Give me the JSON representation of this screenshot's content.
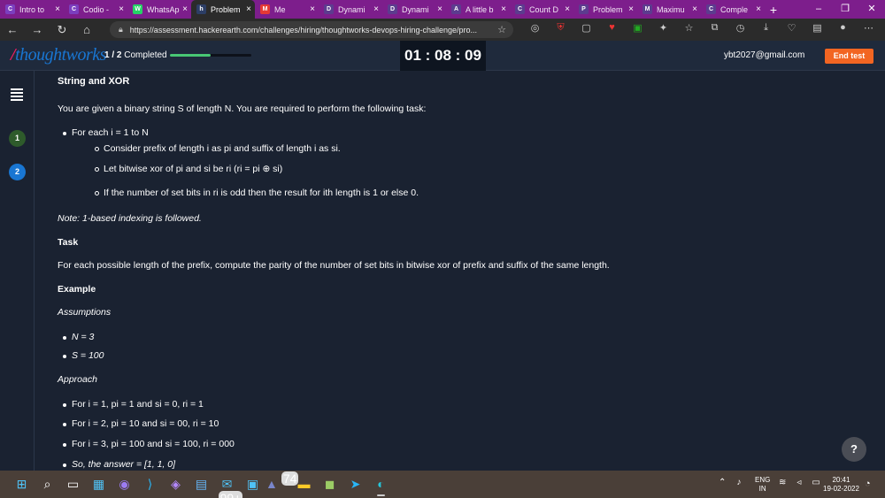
{
  "browser": {
    "tabs": [
      {
        "label": "Intro to",
        "icon": "C",
        "color": "#7b3fbf"
      },
      {
        "label": "Codio -",
        "icon": "C",
        "color": "#7b3fbf"
      },
      {
        "label": "WhatsAp",
        "icon": "W",
        "color": "#25d366"
      },
      {
        "label": "Problem",
        "icon": "h",
        "color": "#2c3e66",
        "active": true
      },
      {
        "label": "Me",
        "icon": "M",
        "color": "#e53935"
      },
      {
        "label": "Dynami",
        "icon": "D",
        "color": "#5c3c8f"
      },
      {
        "label": "Dynami",
        "icon": "D",
        "color": "#5c3c8f"
      },
      {
        "label": "A little b",
        "icon": "A",
        "color": "#5c3c8f"
      },
      {
        "label": "Count D",
        "icon": "C",
        "color": "#5c3c8f"
      },
      {
        "label": "Problem",
        "icon": "P",
        "color": "#5c3c8f"
      },
      {
        "label": "Maximu",
        "icon": "M",
        "color": "#5c3c8f"
      },
      {
        "label": "Comple",
        "icon": "C",
        "color": "#5c3c8f"
      }
    ],
    "url": "https://assessment.hackerearth.com/challenges/hiring/thoughtworks-devops-hiring-challenge/pro..."
  },
  "header": {
    "logo": "thoughtworks",
    "progress_count": "1 / 2",
    "progress_label": "Completed",
    "progress_fraction": 0.5,
    "timer": "01 : 08 : 09",
    "email": "ybt2027@gmail.com",
    "end_test_label": "End test"
  },
  "sidebar": {
    "questions": [
      "1",
      "2"
    ]
  },
  "problem": {
    "title": "String and XOR",
    "intro": "You are given a binary string S of length N. You are required to perform the following task:",
    "bullet_main": "For each i = 1 to N",
    "sub1": "Consider prefix of length i as pi and suffix of length i as si.",
    "sub2": "Let bitwise xor of pi and si be ri (ri = pi ⊕ si)",
    "sub3": "If the number of set bits in ri is odd then the result for ith length is 1 or else 0.",
    "note": "Note: 1-based indexing is followed.",
    "task_heading": "Task",
    "task_text": "For each possible length of the prefix, compute the parity of the number of set bits in bitwise xor of prefix and suffix of the same length.",
    "example_heading": "Example",
    "assumptions_heading": "Assumptions",
    "assumption_n": "N = 3",
    "assumption_s": "S = 100",
    "approach_heading": "Approach",
    "approach1": "For i = 1, pi = 1 and si = 0, ri = 1",
    "approach2": "For i = 2, pi = 10 and si = 00, ri = 10",
    "approach3": "For i = 3, pi = 100 and si = 100, ri = 000",
    "answer": "So, the answer = [1, 1, 0]"
  },
  "taskbar": {
    "mail_badge": "99+",
    "teams_badge": "74",
    "lang_top": "ENG",
    "lang_bottom": "IN",
    "time": "20:41",
    "date": "19-02-2022"
  }
}
